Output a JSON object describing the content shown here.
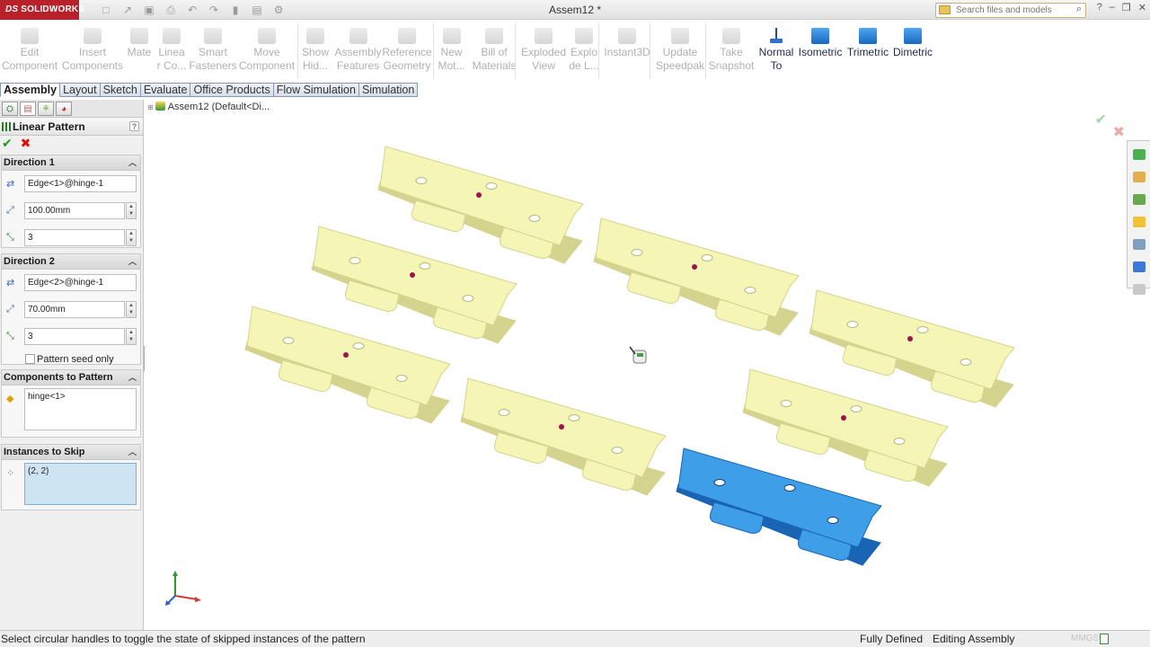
{
  "app": {
    "logo_text": "SOLIDWORKS",
    "logo_mark": "DS",
    "document_title": "Assem12 *"
  },
  "search": {
    "placeholder": "Search files and models"
  },
  "command_manager": {
    "buttons": [
      {
        "label_1": "Edit",
        "label_2": "Component",
        "icon": "edit-component-icon",
        "enabled": false
      },
      {
        "label_1": "Insert",
        "label_2": "Components",
        "icon": "insert-components-icon",
        "enabled": false
      },
      {
        "label_1": "Mate",
        "label_2": "",
        "icon": "mate-icon",
        "enabled": false
      },
      {
        "label_1": "Linea",
        "label_2": "r Co...",
        "icon": "linear-component-pattern-icon",
        "enabled": false
      },
      {
        "label_1": "Smart",
        "label_2": "Fasteners",
        "icon": "smart-fasteners-icon",
        "enabled": false
      },
      {
        "label_1": "Move",
        "label_2": "Component",
        "icon": "move-component-icon",
        "enabled": false
      },
      {
        "label_1": "Show",
        "label_2": "Hid...",
        "icon": "show-hidden-icon",
        "enabled": false
      },
      {
        "label_1": "Assembly",
        "label_2": "Features",
        "icon": "assembly-features-icon",
        "enabled": false
      },
      {
        "label_1": "Reference",
        "label_2": "Geometry",
        "icon": "reference-geometry-icon",
        "enabled": false
      },
      {
        "label_1": "New",
        "label_2": "Mot...",
        "icon": "new-motion-study-icon",
        "enabled": false
      },
      {
        "label_1": "Bill of",
        "label_2": "Materials",
        "icon": "bill-of-materials-icon",
        "enabled": false
      },
      {
        "label_1": "Exploded",
        "label_2": "View",
        "icon": "exploded-view-icon",
        "enabled": false
      },
      {
        "label_1": "Explo",
        "label_2": "de L...",
        "icon": "explode-line-sketch-icon",
        "enabled": false
      },
      {
        "label_1": "Instant3D",
        "label_2": "",
        "icon": "instant3d-icon",
        "enabled": false
      },
      {
        "label_1": "Update",
        "label_2": "Speedpak",
        "icon": "update-speedpak-icon",
        "enabled": false
      },
      {
        "label_1": "Take",
        "label_2": "Snapshot",
        "icon": "take-snapshot-icon",
        "enabled": false
      },
      {
        "label_1": "Normal",
        "label_2": "To",
        "icon": "normal-to-icon",
        "enabled": true
      },
      {
        "label_1": "Isometric",
        "label_2": "",
        "icon": "isometric-view-icon",
        "enabled": true
      },
      {
        "label_1": "Trimetric",
        "label_2": "",
        "icon": "trimetric-view-icon",
        "enabled": true
      },
      {
        "label_1": "Dimetric",
        "label_2": "",
        "icon": "dimetric-view-icon",
        "enabled": true
      }
    ]
  },
  "tabs": [
    {
      "label": "Assembly",
      "active": true
    },
    {
      "label": "Layout",
      "active": false
    },
    {
      "label": "Sketch",
      "active": false
    },
    {
      "label": "Evaluate",
      "active": false
    },
    {
      "label": "Office Products",
      "active": false
    },
    {
      "label": "Flow Simulation",
      "active": false
    },
    {
      "label": "Simulation",
      "active": false
    }
  ],
  "property_manager": {
    "title": "Linear Pattern",
    "help": "?",
    "direction1": {
      "header": "Direction 1",
      "edge": "Edge<1>@hinge-1",
      "spacing": "100.00mm",
      "instances": "3"
    },
    "direction2": {
      "header": "Direction 2",
      "edge": "Edge<2>@hinge-1",
      "spacing": "70.00mm",
      "instances": "3",
      "seed_only_label": "Pattern seed only",
      "seed_only_checked": false
    },
    "components": {
      "header": "Components to Pattern",
      "items": [
        "hinge<1>"
      ]
    },
    "skip": {
      "header": "Instances to Skip",
      "items": [
        "(2, 2)"
      ]
    }
  },
  "viewport": {
    "tree_root": "Assem12  (Default<Di...",
    "colors": {
      "pattern_instance": "#f5f5b6",
      "pattern_edge": "#d4d48e",
      "seed_part": "#3f9ee8",
      "seed_edge": "#1a64b4",
      "skip_handle": "#a0124a"
    }
  },
  "statusbar": {
    "message": "Select circular handles to toggle the state of skipped instances of the pattern",
    "definition": "Fully Defined",
    "mode": "Editing Assembly",
    "units": "MMGS"
  }
}
